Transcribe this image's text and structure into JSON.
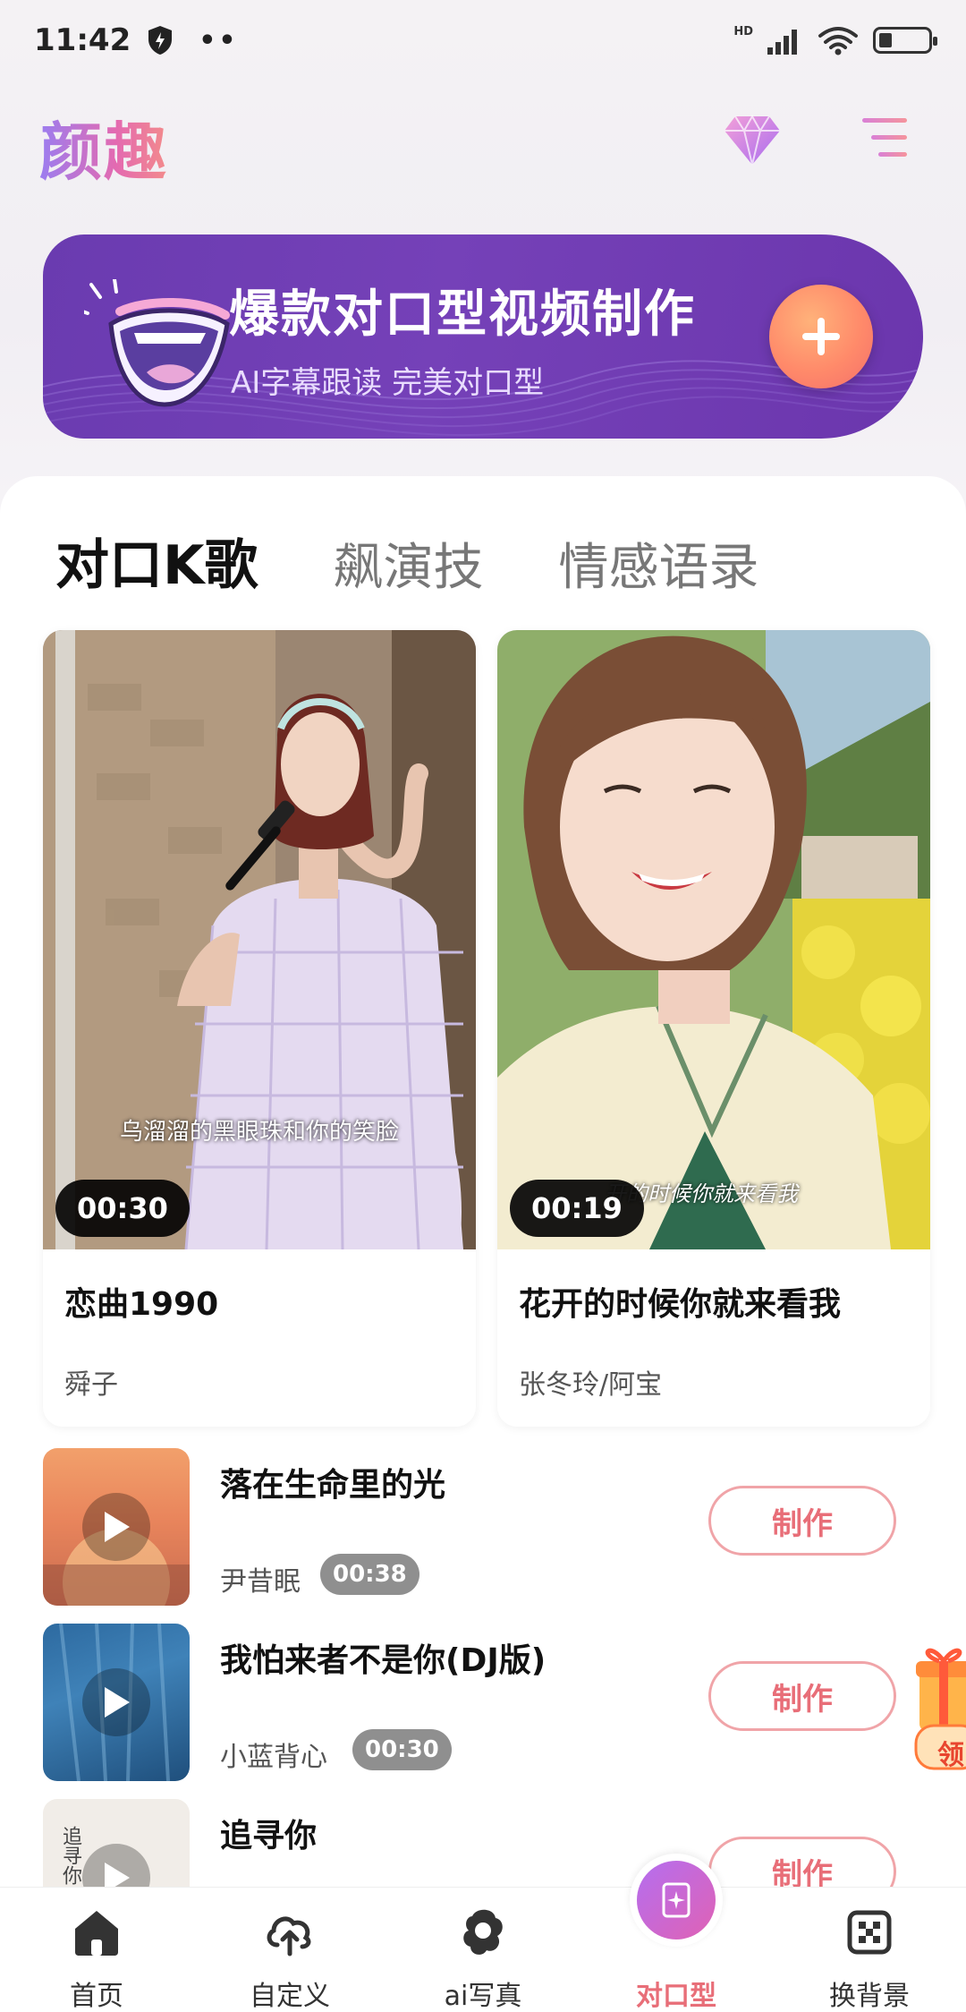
{
  "status": {
    "time": "11:42",
    "dots": "••",
    "hd": "HD"
  },
  "header": {
    "logo": "颜趣"
  },
  "banner": {
    "title": "爆款对口型视频制作",
    "subtitle": "AI字幕跟读 完美对口型"
  },
  "tabs": [
    {
      "label": "对口K歌",
      "active": true
    },
    {
      "label": "飙演技",
      "active": false
    },
    {
      "label": "情感语录",
      "active": false
    }
  ],
  "cards": [
    {
      "title": "恋曲1990",
      "artist": "舜子",
      "duration": "00:30",
      "subtitle_text": "乌溜溜的黑眼珠和你的笑脸"
    },
    {
      "title": "花开的时候你就来看我",
      "artist": "张冬玲/阿宝",
      "duration": "00:19",
      "subtitle_text": "开的时候你就来看我"
    }
  ],
  "list": [
    {
      "title": "落在生命里的光",
      "artist": "尹昔眠",
      "duration": "00:38",
      "button": "制作"
    },
    {
      "title": "我怕来者不是你(DJ版)",
      "artist": "小蓝背心",
      "duration": "00:30",
      "button": "制作"
    },
    {
      "title": "追寻你",
      "artist": "",
      "duration": "",
      "button": "制作",
      "thumb_text": "追寻你"
    }
  ],
  "gift": {
    "label": "领"
  },
  "nav": [
    {
      "label": "首页",
      "icon": "home-icon"
    },
    {
      "label": "自定义",
      "icon": "upload-icon"
    },
    {
      "label": "ai写真",
      "icon": "portrait-icon"
    },
    {
      "label": "对口型",
      "icon": "lipsync-icon",
      "active": true
    },
    {
      "label": "换背景",
      "icon": "background-swap-icon"
    }
  ],
  "colors": {
    "accent": "#e86e78",
    "banner": "#6a3bb0",
    "plus": "#ff8a6a"
  }
}
